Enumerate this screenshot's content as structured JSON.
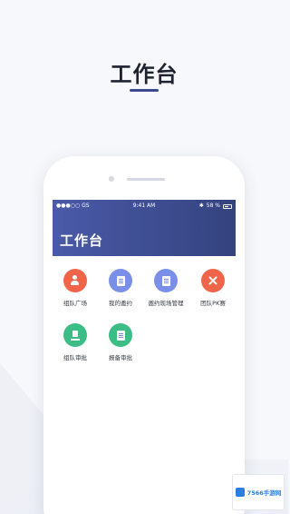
{
  "page": {
    "title": "工作台"
  },
  "status_bar": {
    "carrier": "●●●○○ GS",
    "time": "9:41 AM",
    "battery": "58 %"
  },
  "app": {
    "title": "工作台"
  },
  "tiles": [
    {
      "label": "组队广场",
      "color": "#f0654a",
      "icon": "team-person-icon"
    },
    {
      "label": "我的邀约",
      "color": "#7a90e8",
      "icon": "document-icon"
    },
    {
      "label": "邀约现场管理",
      "color": "#7a90e8",
      "icon": "document-settings-icon"
    },
    {
      "label": "团队PK赛",
      "color": "#f0654a",
      "icon": "crossed-swords-icon"
    },
    {
      "label": "组队审批",
      "color": "#3dbd86",
      "icon": "upload-icon"
    },
    {
      "label": "报备审批",
      "color": "#3dbd86",
      "icon": "report-document-icon"
    }
  ],
  "watermark": {
    "text": "7566手游网"
  },
  "colors": {
    "accent": "#3b4a8c",
    "header_start": "#4a5aa8",
    "header_end": "#34437e"
  }
}
